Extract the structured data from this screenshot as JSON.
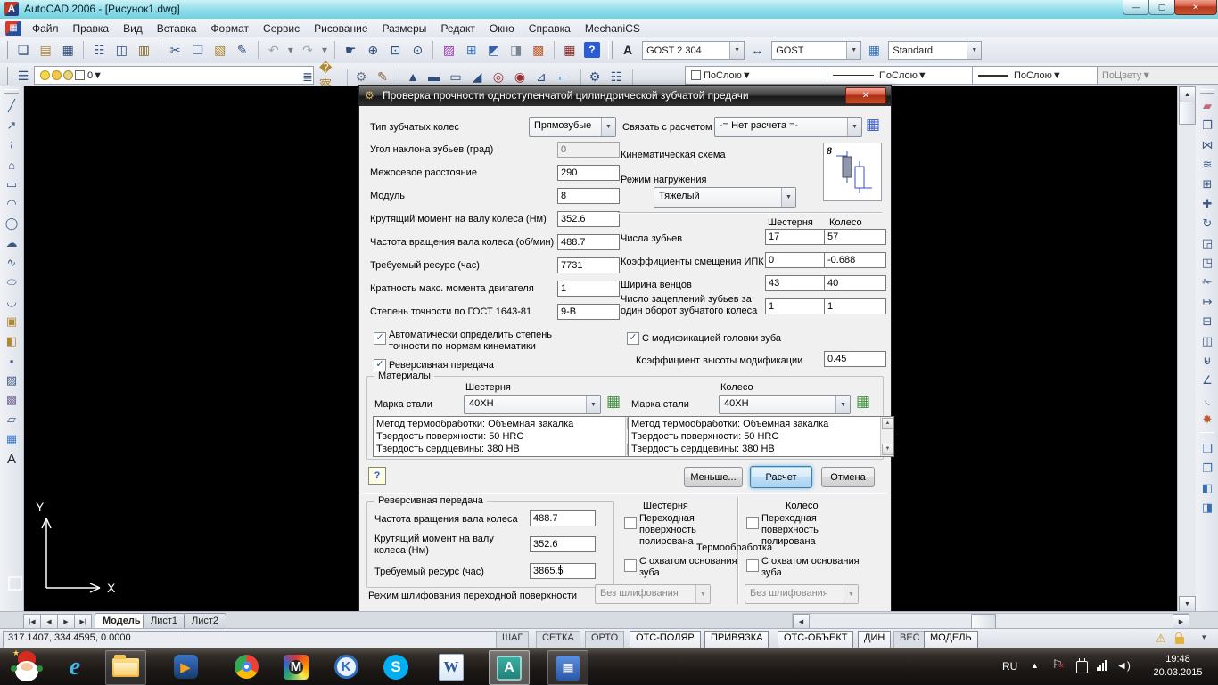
{
  "window": {
    "title": "AutoCAD 2006 - [Рисунок1.dwg]"
  },
  "menu": {
    "items": [
      "Файл",
      "Правка",
      "Вид",
      "Вставка",
      "Формат",
      "Сервис",
      "Рисование",
      "Размеры",
      "Редакт",
      "Окно",
      "Справка",
      "MechaniCS"
    ]
  },
  "toolbars": {
    "text_style": "GOST 2.304",
    "dim_style": "GOST",
    "table_style": "Standard",
    "layer": "0",
    "color": "ПоСлою",
    "linetype": "ПоСлою",
    "lineweight": "ПоСлою",
    "plot_style": "ПоЦвету"
  },
  "dialog": {
    "title": "Проверка прочности одноступенчатой цилиндрической зубчатой предачи",
    "top": {
      "gear_type_label": "Тип зубчатых колес",
      "gear_type_value": "Прямозубые",
      "link_label": "Связать с расчетом",
      "link_value": "-= Нет расчета =-"
    },
    "left_fields": [
      {
        "label": "Угол наклона зубьев (град)",
        "value": "0"
      },
      {
        "label": "Межосевое расстояние",
        "value": "290"
      },
      {
        "label": "Модуль",
        "value": "8"
      },
      {
        "label": "Крутящий момент на валу колеса (Нм)",
        "value": "352.6"
      },
      {
        "label": "Частота вращения вала колеса (об/мин)",
        "value": "488.7"
      },
      {
        "label": "Требуемый ресурс (час)",
        "value": "7731"
      },
      {
        "label": "Кратность макс. момента двигателя",
        "value": "1"
      },
      {
        "label": "Степень точности по ГОСТ 1643-81",
        "value": "9-В"
      }
    ],
    "checks": {
      "auto_precision": "Автоматически определить степень точности по нормам кинематики",
      "reversive": "Реверсивная передача",
      "modification": "С модификацией головки зуба"
    },
    "right": {
      "kinematic_label": "Кинематическая схема",
      "scheme_number": "8",
      "load_mode_label": "Режим нагружения",
      "load_mode_value": "Тяжелый",
      "col_gear": "Шестерня",
      "col_wheel": "Колесо",
      "pair_fields": [
        {
          "label": "Числа зубьев",
          "gear": "17",
          "wheel": "57"
        },
        {
          "label": "Коэффициенты смещения ИПК",
          "gear": "0",
          "wheel": "-0.688"
        },
        {
          "label": "Ширина венцов",
          "gear": "43",
          "wheel": "40"
        },
        {
          "label": "Число зацеплений зубьев за один оборот зубчатого колеса",
          "gear": "1",
          "wheel": "1"
        }
      ],
      "mod_coeff_label": "Коэффициент высоты модификации",
      "mod_coeff_value": "0.45"
    },
    "materials": {
      "group_label": "Материалы",
      "col_gear": "Шестерня",
      "col_wheel": "Колесо",
      "steel_label": "Марка стали",
      "gear_steel": "40ХН",
      "wheel_steel": "40ХН",
      "info_line1": "Метод термообработки: Объемная закалка",
      "info_line2": "Твердость поверхности: 50 HRC",
      "info_line3": "Твердость сердцевины: 380 HB"
    },
    "buttons": {
      "help": "?",
      "less": "Меньше...",
      "calc": "Расчет",
      "cancel": "Отмена"
    },
    "reverse_group": {
      "title": "Реверсивная передача",
      "fields": [
        {
          "label": "Частота вращения вала колеса",
          "value": "488.7"
        },
        {
          "label": "Крутящий момент на валу колеса (Нм)",
          "value": "352.6"
        },
        {
          "label": "Требуемый ресурс (час)",
          "value": "3865.5"
        }
      ]
    },
    "bottom": {
      "col_gear": "Шестерня",
      "col_wheel": "Колесо",
      "cb_surface": "Переходная поверхность полирована",
      "heat_label": "Термообработка",
      "cb_base": "С охватом основания зуба",
      "grind_label": "Режим шлифования переходной поверхности",
      "grind_value": "Без шлифования"
    }
  },
  "tabs": {
    "model": "Модель",
    "sheet1": "Лист1",
    "sheet2": "Лист2"
  },
  "statusbar": {
    "coords": "317.1407, 334.4595, 0.0000",
    "toggles": [
      {
        "label": "ШАГ",
        "on": false
      },
      {
        "label": "СЕТКА",
        "on": false
      },
      {
        "label": "ОРТО",
        "on": false
      },
      {
        "label": "ОТС-ПОЛЯР",
        "on": true
      },
      {
        "label": "ПРИВЯЗКА",
        "on": true
      },
      {
        "label": "ОТС-ОБЪЕКТ",
        "on": true
      },
      {
        "label": "ДИН",
        "on": true
      },
      {
        "label": "ВЕС",
        "on": false
      },
      {
        "label": "МОДЕЛЬ",
        "on": true
      }
    ]
  },
  "tray": {
    "lang": "RU",
    "time": "19:48",
    "date": "20.03.2015"
  },
  "ucs": {
    "x_label": "X",
    "y_label": "Y"
  }
}
